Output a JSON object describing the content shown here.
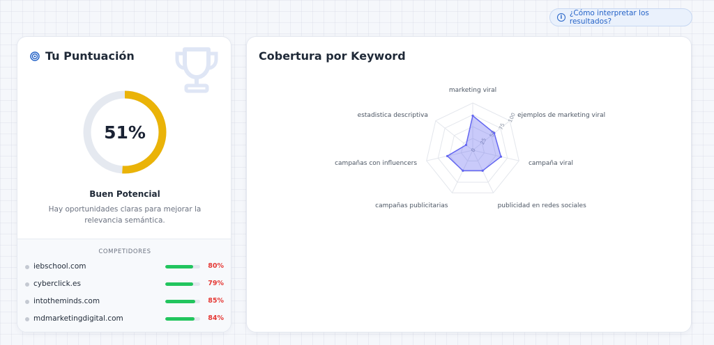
{
  "help": {
    "label": "¿Cómo interpretar los resultados?",
    "icon": "info-icon"
  },
  "score": {
    "title": "Tu Puntuación",
    "title_icon": "target-icon",
    "decor_icon": "trophy-icon",
    "value": 51,
    "value_label": "51%",
    "level": "Buen Potencial",
    "description": "Hay oportunidades claras para mejorar la relevancia semántica.",
    "accent_color": "#eab308",
    "track_color": "#e5e9f0"
  },
  "competitors": {
    "heading": "COMPETIDORES",
    "items": [
      {
        "name": "iebschool.com",
        "value": 80,
        "label": "80%"
      },
      {
        "name": "cyberclick.es",
        "value": 79,
        "label": "79%"
      },
      {
        "name": "intotheminds.com",
        "value": 85,
        "label": "85%"
      },
      {
        "name": "mdmarketingdigital.com",
        "value": 84,
        "label": "84%"
      }
    ],
    "bar_color": "#22c55e",
    "pct_color": "#e53935"
  },
  "keyword_card": {
    "title": "Cobertura por Keyword"
  },
  "chart_data": {
    "type": "radar",
    "categories": [
      "marketing viral",
      "ejemplos de marketing viral",
      "campaña viral",
      "publicidad en redes sociales",
      "campañas publicitarias",
      "campañas con influencers",
      "estadistica descriptiva"
    ],
    "values": [
      73,
      58,
      61,
      48,
      48,
      55,
      18
    ],
    "rlim": [
      0,
      100
    ],
    "radial_ticks": [
      "0",
      "25",
      "50",
      "75",
      "100"
    ],
    "fill_color": "#6366f1",
    "grid": true
  }
}
